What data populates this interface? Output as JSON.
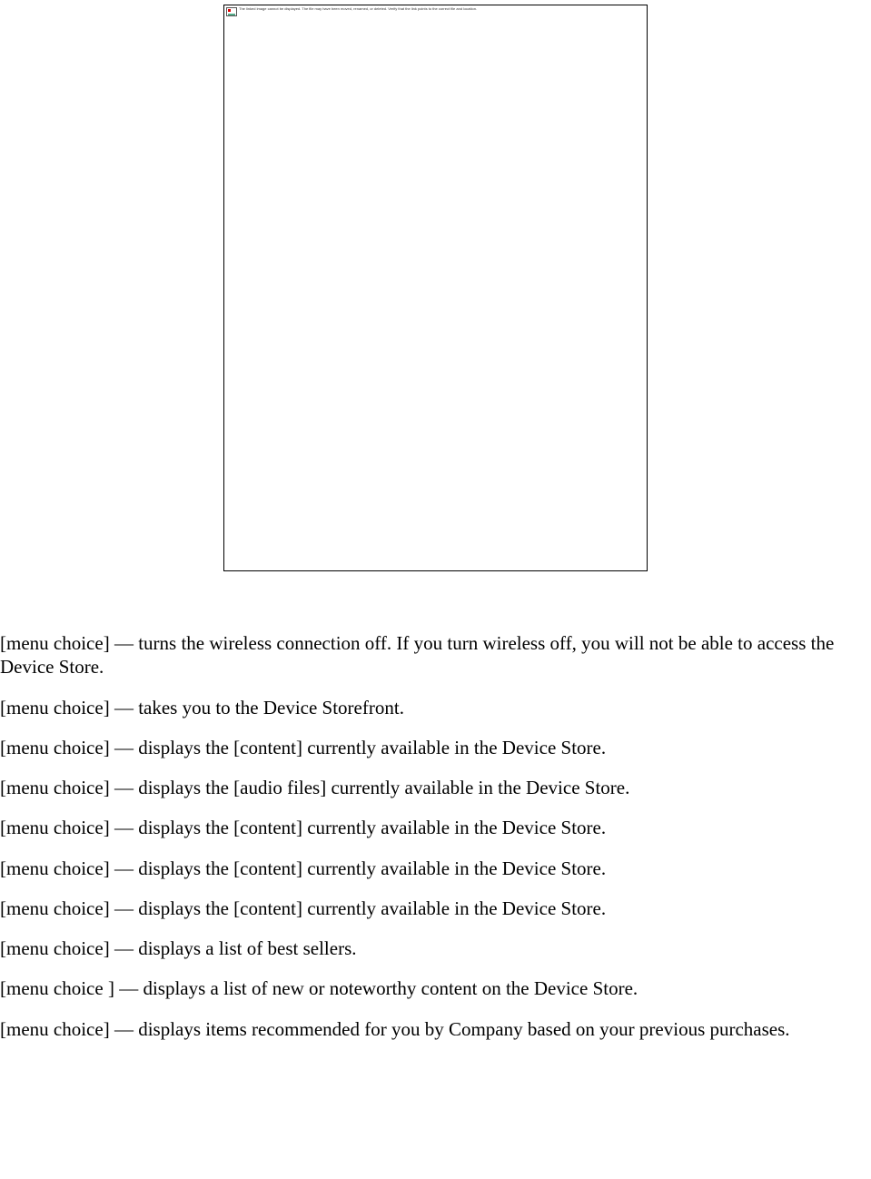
{
  "imagePlaceholder": {
    "altText": "The linked image cannot be displayed. The file may have been moved, renamed, or deleted. Verify that the link points to the correct file and location."
  },
  "entries": [
    "[menu choice] — turns the wireless connection off. If you turn wireless off, you will not be able to access the Device Store.",
    "[menu choice] — takes you to the Device Storefront.",
    "[menu choice] — displays the [content] currently available in the Device Store.",
    "[menu choice] — displays the [audio files] currently available in the Device Store.",
    "[menu choice] — displays the [content] currently available in the Device Store.",
    "[menu choice] — displays the [content] currently available in the Device Store.",
    "[menu choice] — displays the [content] currently available in the Device Store.",
    "[menu choice] — displays a list of best sellers.",
    "[menu choice ] — displays a list of new or noteworthy content on the Device Store.",
    "[menu choice] — displays items recommended for you by Company based on your previous purchases."
  ]
}
